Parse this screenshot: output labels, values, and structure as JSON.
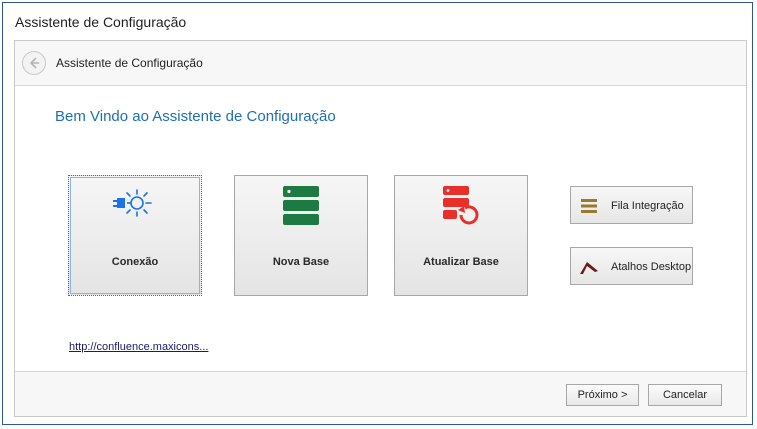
{
  "window": {
    "title": "Assistente de Configuração"
  },
  "nav": {
    "title": "Assistente de Configuração",
    "back_icon": "back-arrow-icon"
  },
  "welcome": "Bem Vindo ao Assistente de Configuração",
  "tiles": [
    {
      "label": "Conexão",
      "icon": "connection-plug-icon"
    },
    {
      "label": "Nova Base",
      "icon": "database-server-icon"
    },
    {
      "label": "Atualizar Base",
      "icon": "database-refresh-icon"
    }
  ],
  "side_buttons": [
    {
      "label": "Fila Integração",
      "icon": "queue-lines-icon"
    },
    {
      "label": "Atalhos Desktop",
      "icon": "shortcut-arrow-icon"
    }
  ],
  "link": "http://confluence.maxicons...",
  "footer": {
    "next": "Próximo >",
    "cancel": "Cancelar"
  },
  "colors": {
    "accent": "#1e6fb5",
    "icon_blue": "#1a73e8",
    "icon_green": "#1e7a43",
    "icon_red": "#e8302a",
    "icon_gold": "#9a7a2e",
    "icon_maroon": "#6e1a1a"
  }
}
